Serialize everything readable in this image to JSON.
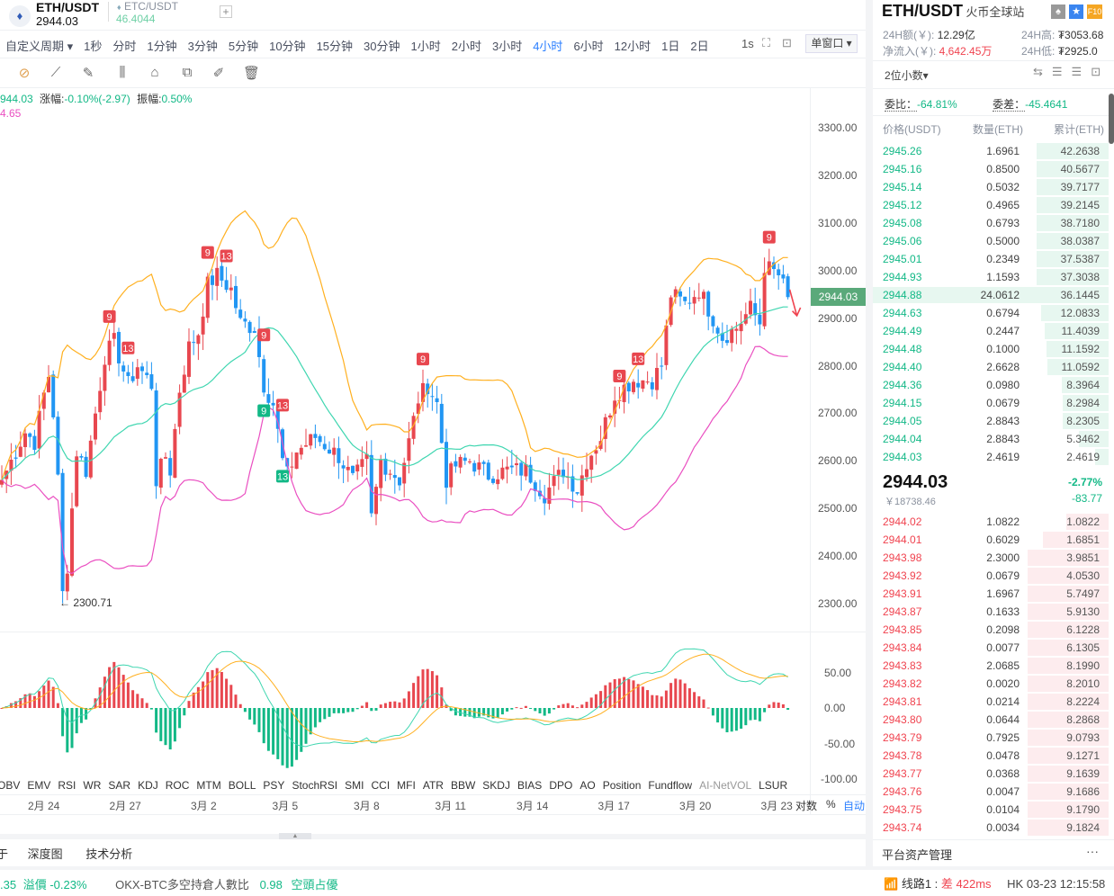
{
  "tabs": [
    {
      "symbol": "ETH/USDT",
      "price": "2944.03"
    },
    {
      "symbol": "ETC/USDT",
      "price": "46.4044"
    }
  ],
  "add_tab": "+",
  "periods": [
    "自定义周期 ▾",
    "1秒",
    "分时",
    "1分钟",
    "3分钟",
    "5分钟",
    "10分钟",
    "15分钟",
    "30分钟",
    "1小时",
    "2小时",
    "3小时",
    "4小时",
    "6小时",
    "12小时",
    "1日",
    "2日"
  ],
  "active_period": "4小时",
  "toolbar_right": {
    "interval": "1s",
    "window": "单窗口 ▾"
  },
  "legend": {
    "price": "944.03",
    "change_label": "涨幅:",
    "change": "-0.10%(-2.97)",
    "amp_label": "振幅:",
    "amp": "0.50%",
    "line2": "4.65"
  },
  "price_axis": [
    "3300.00",
    "3200.00",
    "3100.00",
    "3000.00",
    "2900.00",
    "2800.00",
    "2700.00",
    "2600.00",
    "2500.00",
    "2400.00",
    "2300.00"
  ],
  "last_price_tag": "2944.03",
  "low_marker": "← 2300.71",
  "macd_axis": [
    "50.00",
    "0.00",
    "-50.00",
    "-100.00"
  ],
  "indicators": [
    "OBV",
    "EMV",
    "RSI",
    "WR",
    "SAR",
    "KDJ",
    "ROC",
    "MTM",
    "BOLL",
    "PSY",
    "StochRSI",
    "SMI",
    "CCI",
    "MFI",
    "ATR",
    "BBW",
    "SKDJ",
    "BIAS",
    "DPO",
    "AO",
    "Position",
    "Fundflow",
    "AI-NetVOL",
    "LSUR"
  ],
  "dates": [
    "2月 24",
    "2月 27",
    "3月 2",
    "3月 5",
    "3月 8",
    "3月 11",
    "3月 14",
    "3月 17",
    "3月 20",
    "3月 23"
  ],
  "axis_modes": {
    "log": "对数",
    "pct": "%",
    "auto": "自动"
  },
  "bottom_tabs": [
    "于",
    "深度图",
    "技术分析"
  ],
  "ticker": {
    "a": ".35",
    "b": "溢價 -0.23%",
    "c": "OKX-BTC多空持倉人數比",
    "d": "0.98",
    "e": "空頭占優"
  },
  "status": {
    "line": "线路1 : ",
    "quality": "差 422ms",
    "time": "HK 03-23 12:15:58"
  },
  "right": {
    "title": "ETH/USDT",
    "exchange": "火币全球站",
    "f10": "F10",
    "vol_label": "24H额(￥): ",
    "vol": "12.29亿",
    "high_label": "24H高: ",
    "high": "₮3053.68",
    "flow_label": "净流入(￥): ",
    "flow": "4,642.45万",
    "low_label": "24H低: ",
    "low": "₮2925.0",
    "decimals": "2位小数▾",
    "ratio_label": "委比：",
    "ratio": "-64.81%",
    "diff_label": "委差：",
    "diff": "-45.4641",
    "headers": [
      "价格(USDT)",
      "数量(ETH)",
      "累计(ETH)"
    ],
    "asks": [
      [
        "2945.26",
        "1.6961",
        "42.2638"
      ],
      [
        "2945.16",
        "0.8500",
        "40.5677"
      ],
      [
        "2945.14",
        "0.5032",
        "39.7177"
      ],
      [
        "2945.12",
        "0.4965",
        "39.2145"
      ],
      [
        "2945.08",
        "0.6793",
        "38.7180"
      ],
      [
        "2945.06",
        "0.5000",
        "38.0387"
      ],
      [
        "2945.01",
        "0.2349",
        "37.5387"
      ],
      [
        "2944.93",
        "1.1593",
        "37.3038"
      ],
      [
        "2944.88",
        "24.0612",
        "36.1445"
      ],
      [
        "2944.63",
        "0.6794",
        "12.0833"
      ],
      [
        "2944.49",
        "0.2447",
        "11.4039"
      ],
      [
        "2944.48",
        "0.1000",
        "11.1592"
      ],
      [
        "2944.40",
        "2.6628",
        "11.0592"
      ],
      [
        "2944.36",
        "0.0980",
        "8.3964"
      ],
      [
        "2944.15",
        "0.0679",
        "8.2984"
      ],
      [
        "2944.05",
        "2.8843",
        "8.2305"
      ],
      [
        "2944.04",
        "2.8843",
        "5.3462"
      ],
      [
        "2944.03",
        "2.4619",
        "2.4619"
      ]
    ],
    "mid_price": "2944.03",
    "mid_cny": "￥18738.46",
    "mid_pct": "-2.77%",
    "mid_chg": "-83.77",
    "bids": [
      [
        "2944.02",
        "1.0822",
        "1.0822"
      ],
      [
        "2944.01",
        "0.6029",
        "1.6851"
      ],
      [
        "2943.98",
        "2.3000",
        "3.9851"
      ],
      [
        "2943.92",
        "0.0679",
        "4.0530"
      ],
      [
        "2943.91",
        "1.6967",
        "5.7497"
      ],
      [
        "2943.87",
        "0.1633",
        "5.9130"
      ],
      [
        "2943.85",
        "0.2098",
        "6.1228"
      ],
      [
        "2943.84",
        "0.0077",
        "6.1305"
      ],
      [
        "2943.83",
        "2.0685",
        "8.1990"
      ],
      [
        "2943.82",
        "0.0020",
        "8.2010"
      ],
      [
        "2943.81",
        "0.0214",
        "8.2224"
      ],
      [
        "2943.80",
        "0.0644",
        "8.2868"
      ],
      [
        "2943.79",
        "0.7925",
        "9.0793"
      ],
      [
        "2943.78",
        "0.0478",
        "9.1271"
      ],
      [
        "2943.77",
        "0.0368",
        "9.1639"
      ],
      [
        "2943.76",
        "0.0047",
        "9.1686"
      ],
      [
        "2943.75",
        "0.0104",
        "9.1790"
      ],
      [
        "2943.74",
        "0.0034",
        "9.1824"
      ]
    ],
    "footer": "平台资产管理",
    "more": "···"
  },
  "colors": {
    "up": "#e8474f",
    "down": "#2196f3",
    "upper": "#ffb020",
    "mid": "#3fd6b0",
    "lower": "#ea4fc1",
    "green": "#12b886",
    "red": "#f0434f"
  },
  "chart_data": {
    "type": "candlestick",
    "symbol": "ETH/USDT",
    "interval": "4小时",
    "ylim": [
      2300,
      3300
    ],
    "close_keypoints": [
      [
        0,
        2560
      ],
      [
        2,
        2600
      ],
      [
        5,
        2660
      ],
      [
        7,
        2640
      ],
      [
        9,
        2740
      ],
      [
        10,
        2780
      ],
      [
        11,
        2700
      ],
      [
        12,
        2560
      ],
      [
        13,
        2320
      ],
      [
        14,
        2380
      ],
      [
        16,
        2620
      ],
      [
        18,
        2580
      ],
      [
        20,
        2700
      ],
      [
        22,
        2820
      ],
      [
        24,
        2850
      ],
      [
        27,
        2760
      ],
      [
        29,
        2800
      ],
      [
        32,
        2760
      ],
      [
        33,
        2560
      ],
      [
        35,
        2610
      ],
      [
        36,
        2580
      ],
      [
        38,
        2750
      ],
      [
        40,
        2840
      ],
      [
        42,
        2870
      ],
      [
        44,
        2970
      ],
      [
        46,
        2990
      ],
      [
        49,
        2960
      ],
      [
        51,
        2890
      ],
      [
        54,
        2880
      ],
      [
        56,
        2760
      ],
      [
        58,
        2720
      ],
      [
        60,
        2600
      ],
      [
        61,
        2570
      ],
      [
        63,
        2620
      ],
      [
        67,
        2650
      ],
      [
        72,
        2610
      ],
      [
        75,
        2560
      ],
      [
        78,
        2600
      ],
      [
        79,
        2480
      ],
      [
        81,
        2600
      ],
      [
        85,
        2560
      ],
      [
        87,
        2640
      ],
      [
        89,
        2730
      ],
      [
        91,
        2760
      ],
      [
        93,
        2720
      ],
      [
        95,
        2560
      ],
      [
        97,
        2590
      ],
      [
        100,
        2600
      ],
      [
        104,
        2570
      ],
      [
        108,
        2580
      ],
      [
        112,
        2580
      ],
      [
        116,
        2530
      ],
      [
        120,
        2580
      ],
      [
        123,
        2540
      ],
      [
        125,
        2600
      ],
      [
        128,
        2650
      ],
      [
        131,
        2740
      ],
      [
        135,
        2770
      ],
      [
        139,
        2770
      ],
      [
        141,
        2800
      ],
      [
        143,
        2950
      ],
      [
        146,
        2930
      ],
      [
        149,
        2960
      ],
      [
        152,
        2900
      ],
      [
        154,
        2860
      ],
      [
        157,
        2880
      ],
      [
        160,
        2920
      ],
      [
        162,
        2890
      ],
      [
        163,
        3010
      ],
      [
        166,
        2990
      ],
      [
        168,
        2944.03
      ]
    ],
    "low": 2300.71,
    "td_marks": [
      [
        23,
        "9"
      ],
      [
        27,
        "13"
      ],
      [
        44,
        "9"
      ],
      [
        48,
        "13"
      ],
      [
        56,
        "9"
      ],
      [
        60,
        "13"
      ],
      [
        90,
        "9"
      ],
      [
        132,
        "9"
      ],
      [
        136,
        "13"
      ],
      [
        164,
        "9"
      ]
    ]
  }
}
